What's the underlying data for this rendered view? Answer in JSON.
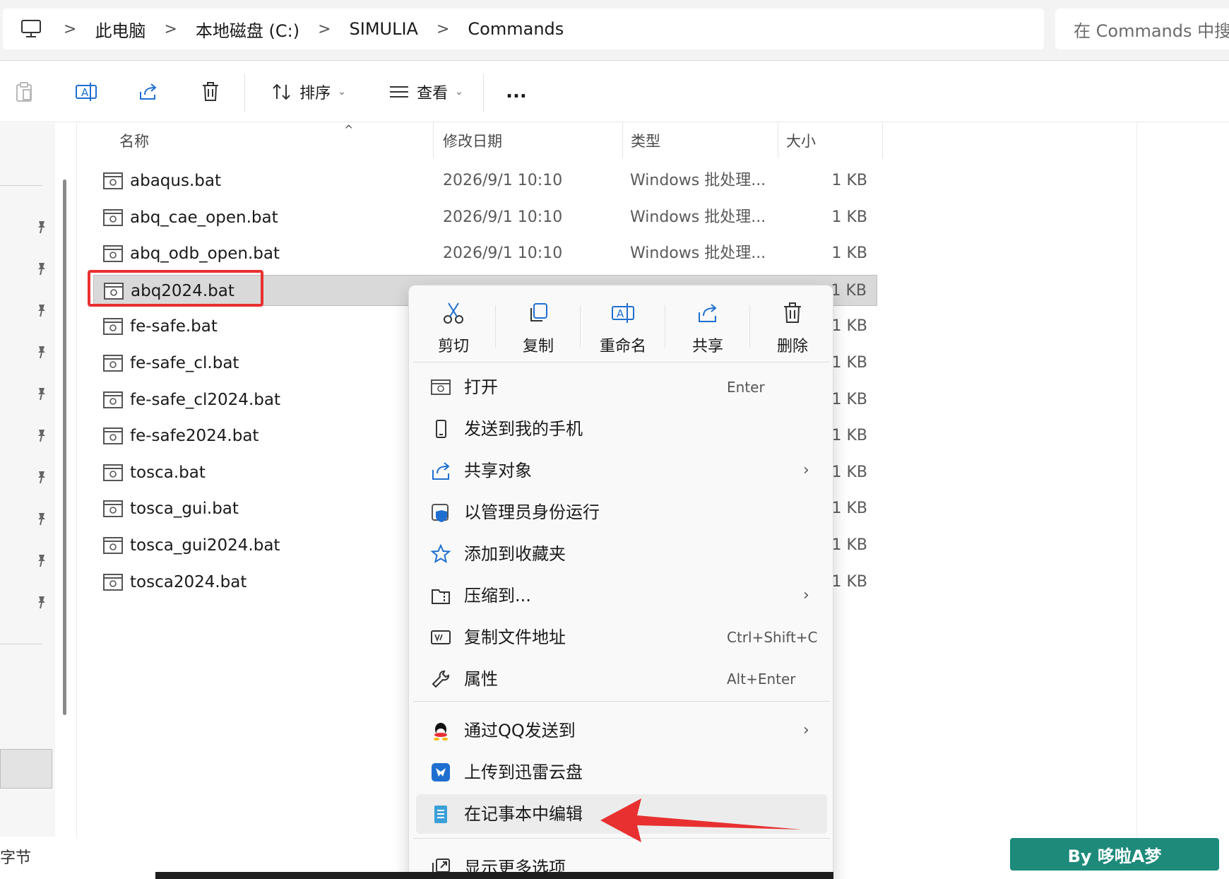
{
  "breadcrumb": {
    "items": [
      "此电脑",
      "本地磁盘 (C:)",
      "SIMULIA",
      "Commands"
    ],
    "search_placeholder": "在 Commands 中搜"
  },
  "toolbar": {
    "sort_label": "排序",
    "view_label": "查看",
    "more_label": "..."
  },
  "columns": {
    "name": "名称",
    "modified": "修改日期",
    "type": "类型",
    "size": "大小"
  },
  "files": [
    {
      "name": "abaqus.bat",
      "date": "2026/9/1 10:10",
      "type": "Windows 批处理...",
      "size": "1 KB"
    },
    {
      "name": "abq_cae_open.bat",
      "date": "2026/9/1 10:10",
      "type": "Windows 批处理...",
      "size": "1 KB"
    },
    {
      "name": "abq_odb_open.bat",
      "date": "2026/9/1 10:10",
      "type": "Windows 批处理...",
      "size": "1 KB"
    },
    {
      "name": "abq2024.bat",
      "date": "",
      "type": "",
      "size": "1 KB"
    },
    {
      "name": "fe-safe.bat",
      "date": "",
      "type": "",
      "size": "1 KB"
    },
    {
      "name": "fe-safe_cl.bat",
      "date": "",
      "type": "",
      "size": "1 KB"
    },
    {
      "name": "fe-safe_cl2024.bat",
      "date": "",
      "type": "",
      "size": "1 KB"
    },
    {
      "name": "fe-safe2024.bat",
      "date": "",
      "type": "",
      "size": "1 KB"
    },
    {
      "name": "tosca.bat",
      "date": "",
      "type": "",
      "size": "1 KB"
    },
    {
      "name": "tosca_gui.bat",
      "date": "",
      "type": "",
      "size": "1 KB"
    },
    {
      "name": "tosca_gui2024.bat",
      "date": "",
      "type": "",
      "size": "1 KB"
    },
    {
      "name": "tosca2024.bat",
      "date": "",
      "type": "",
      "size": "1 KB"
    }
  ],
  "status": {
    "left_text": "字节"
  },
  "context_menu": {
    "quick_actions": [
      "剪切",
      "复制",
      "重命名",
      "共享",
      "删除"
    ],
    "items": [
      {
        "label": "打开",
        "shortcut": "Enter",
        "submenu": false,
        "icon": "bat-file-icon"
      },
      {
        "label": "发送到我的手机",
        "shortcut": "",
        "submenu": false,
        "icon": "phone-icon"
      },
      {
        "label": "共享对象",
        "shortcut": "",
        "submenu": true,
        "icon": "share-icon"
      },
      {
        "label": "以管理员身份运行",
        "shortcut": "",
        "submenu": false,
        "icon": "shield-icon"
      },
      {
        "label": "添加到收藏夹",
        "shortcut": "",
        "submenu": false,
        "icon": "star-icon"
      },
      {
        "label": "压缩到...",
        "shortcut": "",
        "submenu": true,
        "icon": "zip-folder-icon"
      },
      {
        "label": "复制文件地址",
        "shortcut": "Ctrl+Shift+C",
        "submenu": false,
        "icon": "copy-path-icon"
      },
      {
        "label": "属性",
        "shortcut": "Alt+Enter",
        "submenu": false,
        "icon": "wrench-icon"
      },
      {
        "label": "通过QQ发送到",
        "shortcut": "",
        "submenu": true,
        "icon": "qq-icon"
      },
      {
        "label": "上传到迅雷云盘",
        "shortcut": "",
        "submenu": false,
        "icon": "xunlei-icon"
      },
      {
        "label": "在记事本中编辑",
        "shortcut": "",
        "submenu": false,
        "icon": "notepad-icon"
      },
      {
        "label": "显示更多选项",
        "shortcut": "",
        "submenu": false,
        "icon": "more-options-icon"
      }
    ]
  },
  "watermark": "By 哆啦A梦",
  "colors": {
    "selection_outline": "#e83030",
    "arrow": "#e83030",
    "watermark_bg": "#1d8a7a",
    "accent_blue": "#1f6fd1"
  }
}
